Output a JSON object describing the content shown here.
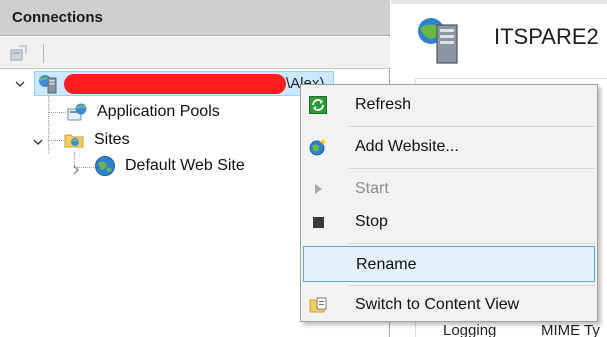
{
  "connections": {
    "title": "Connections",
    "toolbar": {
      "icons": [
        "connect-icon"
      ]
    },
    "tree": {
      "server": {
        "suffix": "\\Alex)",
        "icon": "server-icon",
        "name_redacted": true
      },
      "app_pools": {
        "label": "Application Pools",
        "icon": "app-pools-icon"
      },
      "sites": {
        "label": "Sites",
        "icon": "sites-folder-icon"
      },
      "default_site": {
        "label": "Default Web Site",
        "icon": "globe-icon"
      }
    }
  },
  "right_panel": {
    "title": "ITSPARE2",
    "bottom_left": "Logging",
    "bottom_right": "MIME Ty"
  },
  "context_menu": {
    "items": [
      {
        "label": "Refresh",
        "icon": "refresh-icon",
        "enabled": true
      },
      {
        "label": "Add Website...",
        "icon": "add-website-icon",
        "enabled": true
      },
      {
        "label": "Start",
        "icon": "start-icon",
        "enabled": false
      },
      {
        "label": "Stop",
        "icon": "stop-icon",
        "enabled": true
      },
      {
        "label": "Rename",
        "icon": "",
        "enabled": true,
        "highlighted": true
      },
      {
        "label": "Switch to Content View",
        "icon": "content-view-icon",
        "enabled": true
      }
    ]
  },
  "colors": {
    "header_bg": "#cfcfcf",
    "selection_bg": "#cce8ff",
    "menu_bg": "#f2f2f2",
    "menu_highlight_bg": "#e5f1fb",
    "menu_highlight_border": "#5ba7e0",
    "redaction": "#ff1d1d"
  }
}
